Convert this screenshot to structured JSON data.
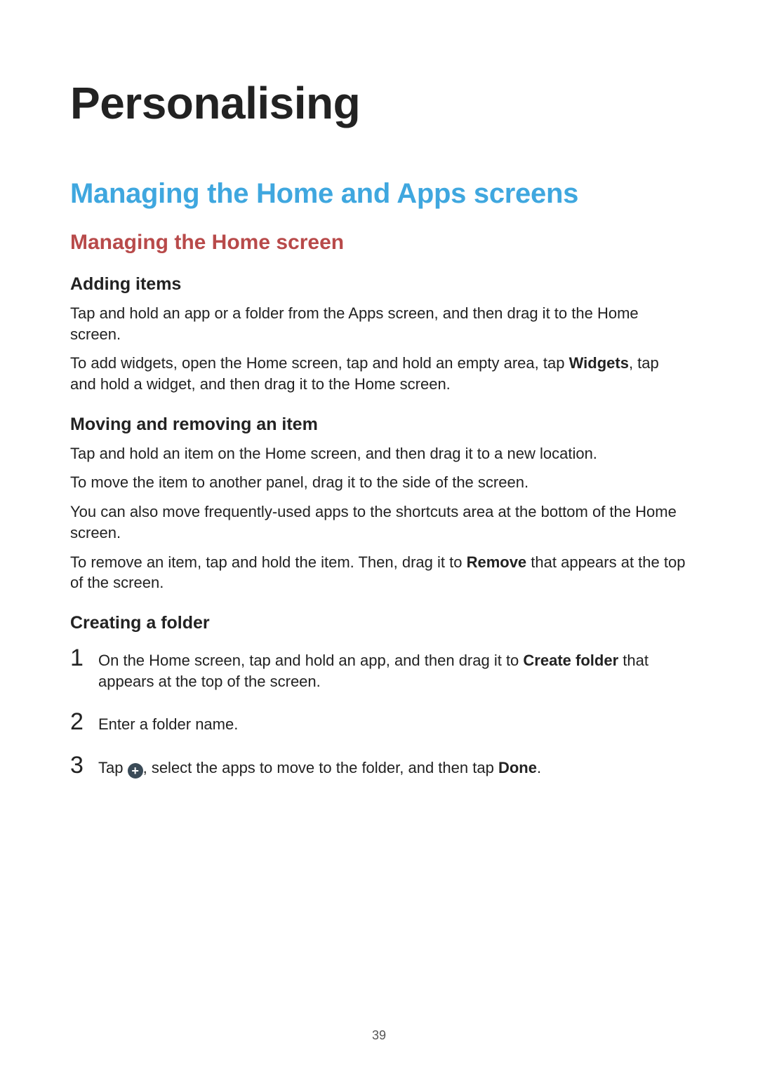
{
  "page_number": "39",
  "h1": "Personalising",
  "h2": "Managing the Home and Apps screens",
  "h3": "Managing the Home screen",
  "sections": {
    "adding_items": {
      "title": "Adding items",
      "p1": "Tap and hold an app or a folder from the Apps screen, and then drag it to the Home screen.",
      "p2a": "To add widgets, open the Home screen, tap and hold an empty area, tap ",
      "p2b_bold": "Widgets",
      "p2c": ", tap and hold a widget, and then drag it to the Home screen."
    },
    "moving_removing": {
      "title": "Moving and removing an item",
      "p1": "Tap and hold an item on the Home screen, and then drag it to a new location.",
      "p2": "To move the item to another panel, drag it to the side of the screen.",
      "p3": "You can also move frequently-used apps to the shortcuts area at the bottom of the Home screen.",
      "p4a": "To remove an item, tap and hold the item. Then, drag it to ",
      "p4b_bold": "Remove",
      "p4c": " that appears at the top of the screen."
    },
    "creating_folder": {
      "title": "Creating a folder",
      "steps": {
        "one_num": "1",
        "one_a": "On the Home screen, tap and hold an app, and then drag it to ",
        "one_b_bold": "Create folder",
        "one_c": " that appears at the top of the screen.",
        "two_num": "2",
        "two": "Enter a folder name.",
        "three_num": "3",
        "three_a": "Tap ",
        "three_b": ", select the apps to move to the folder, and then tap ",
        "three_c_bold": "Done",
        "three_d": "."
      }
    }
  }
}
